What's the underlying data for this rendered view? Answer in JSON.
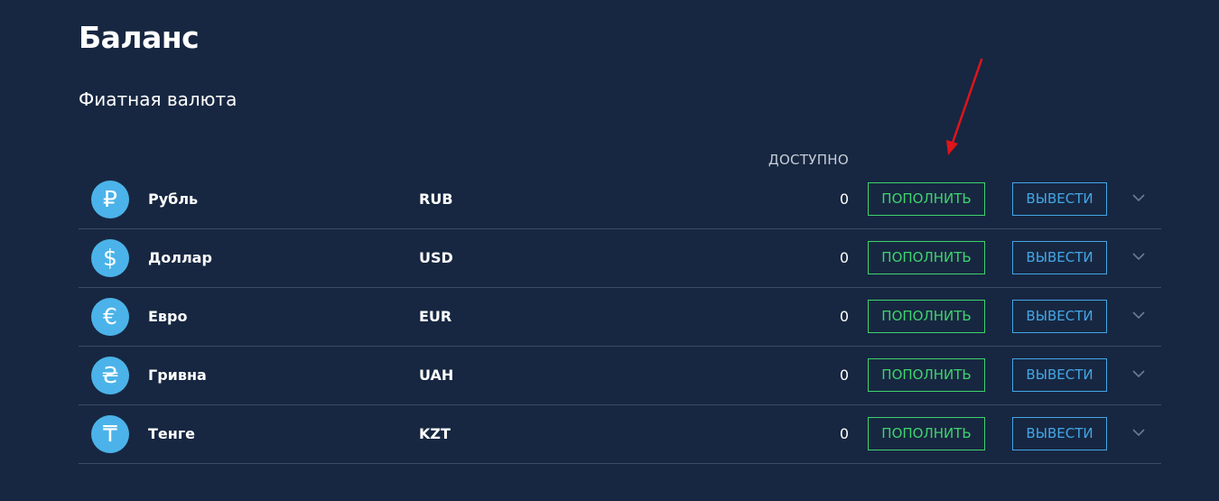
{
  "page": {
    "title": "Баланс",
    "section_title": "Фиатная валюта",
    "available_header": "ДОСТУПНО"
  },
  "currencies": [
    {
      "symbol": "₽",
      "icon": "ruble-icon",
      "name": "Рубль",
      "code": "RUB",
      "amount": "0",
      "deposit_label": "ПОПОЛНИТЬ",
      "withdraw_label": "ВЫВЕСТИ"
    },
    {
      "symbol": "$",
      "icon": "dollar-icon",
      "name": "Доллар",
      "code": "USD",
      "amount": "0",
      "deposit_label": "ПОПОЛНИТЬ",
      "withdraw_label": "ВЫВЕСТИ"
    },
    {
      "symbol": "€",
      "icon": "euro-icon",
      "name": "Евро",
      "code": "EUR",
      "amount": "0",
      "deposit_label": "ПОПОЛНИТЬ",
      "withdraw_label": "ВЫВЕСТИ"
    },
    {
      "symbol": "₴",
      "icon": "hryvnia-icon",
      "name": "Гривна",
      "code": "UAH",
      "amount": "0",
      "deposit_label": "ПОПОЛНИТЬ",
      "withdraw_label": "ВЫВЕСТИ"
    },
    {
      "symbol": "₸",
      "icon": "tenge-icon",
      "name": "Тенге",
      "code": "KZT",
      "amount": "0",
      "deposit_label": "ПОПОЛНИТЬ",
      "withdraw_label": "ВЫВЕСТИ"
    }
  ],
  "colors": {
    "background": "#172741",
    "icon_bg": "#4bb3e9",
    "deposit": "#40d36d",
    "withdraw": "#44a6e6",
    "divider": "#3b4a61",
    "annotation_arrow": "#e0141b"
  }
}
